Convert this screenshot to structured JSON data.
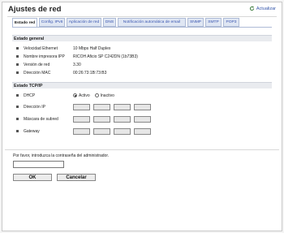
{
  "window": {
    "title": "Ajustes de red",
    "refresh_label": "Actualizar"
  },
  "tabs": [
    {
      "label": "Estado red",
      "active": true
    },
    {
      "label": "Config. IPv6",
      "active": false
    },
    {
      "label": "Aplicación de red",
      "active": false
    },
    {
      "label": "DNS",
      "active": false
    },
    {
      "label": "Notificación automática de email",
      "active": false
    },
    {
      "label": "SNMP",
      "active": false
    },
    {
      "label": "SMTP",
      "active": false
    },
    {
      "label": "POP3",
      "active": false
    }
  ],
  "general": {
    "header": "Estado general",
    "rows": [
      {
        "label": "Velocidad Ethernet",
        "value": "10 Mbps Half Duplex"
      },
      {
        "label": "Nombre impresora IPP",
        "value": "RICOH Aficio SP C242DN (1b73B3)"
      },
      {
        "label": "Versión de red",
        "value": "3.30"
      },
      {
        "label": "Dirección MAC",
        "value": "00:26:73:1B:73:B3"
      }
    ]
  },
  "tcpip": {
    "header": "Estado TCP/IP",
    "dhcp_label": "DHCP",
    "dhcp_on": "Activo",
    "dhcp_off": "Inactivo",
    "ip_label": "Dirección IP",
    "mask_label": "Máscara de subred",
    "gateway_label": "Gateway"
  },
  "auth": {
    "prompt": "Por favor, introduzca la contraseña del administrador.",
    "password_value": ""
  },
  "buttons": {
    "ok": "OK",
    "cancel": "Cancelar"
  }
}
